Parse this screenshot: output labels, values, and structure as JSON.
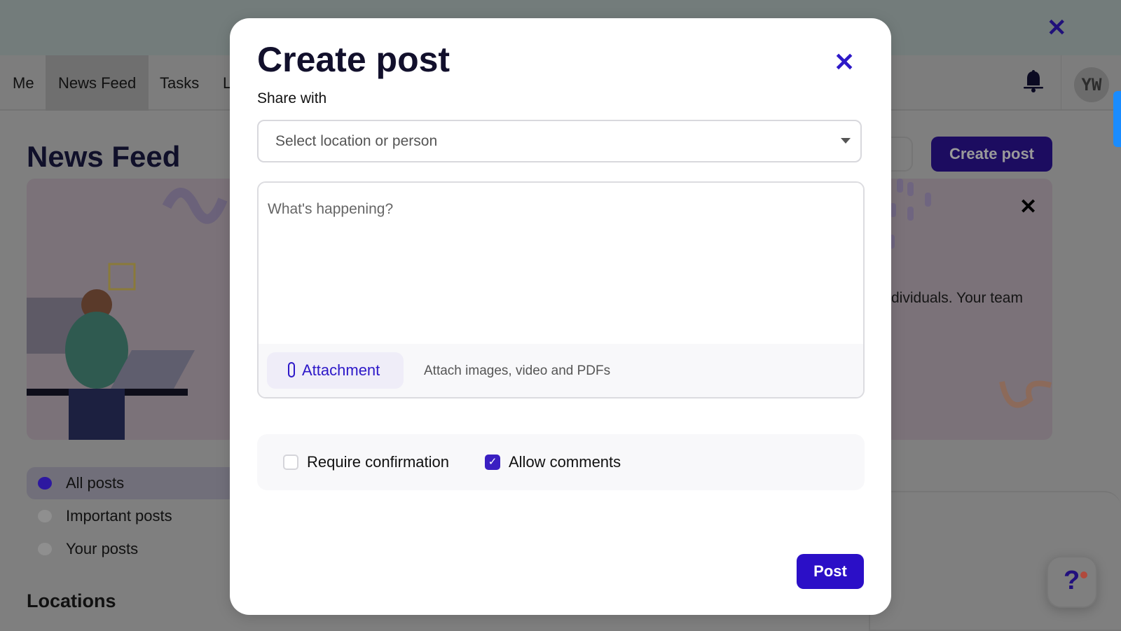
{
  "top_banner": {
    "close_icon": "close-icon"
  },
  "nav": {
    "tabs": [
      {
        "label": "Me"
      },
      {
        "label": "News Feed",
        "active": true
      },
      {
        "label": "Tasks"
      },
      {
        "label": "L"
      }
    ],
    "avatar_initials": "YW"
  },
  "page": {
    "title": "News Feed",
    "create_post_label": "Create post",
    "banner_text": "dividuals. Your team",
    "sidebar": [
      {
        "label": "All posts",
        "icon": "chat-bubble-icon",
        "active": true
      },
      {
        "label": "Important posts",
        "icon": "exclamation-icon"
      },
      {
        "label": "Your posts",
        "icon": "chat-bubble-icon"
      }
    ],
    "locations_heading": "Locations"
  },
  "modal": {
    "title": "Create post",
    "share_with_label": "Share with",
    "share_select_placeholder": "Select location or person",
    "text_placeholder": "What's happening?",
    "attachment_label": "Attachment",
    "attachment_hint": "Attach images, video and PDFs",
    "require_confirmation_label": "Require confirmation",
    "require_confirmation_checked": false,
    "allow_comments_label": "Allow comments",
    "allow_comments_checked": true,
    "post_label": "Post"
  },
  "colors": {
    "accent": "#2b0fc7",
    "overlay": "#7f7f7f",
    "brand_dark": "#1c0c60",
    "help_dot": "#b14a3c"
  }
}
